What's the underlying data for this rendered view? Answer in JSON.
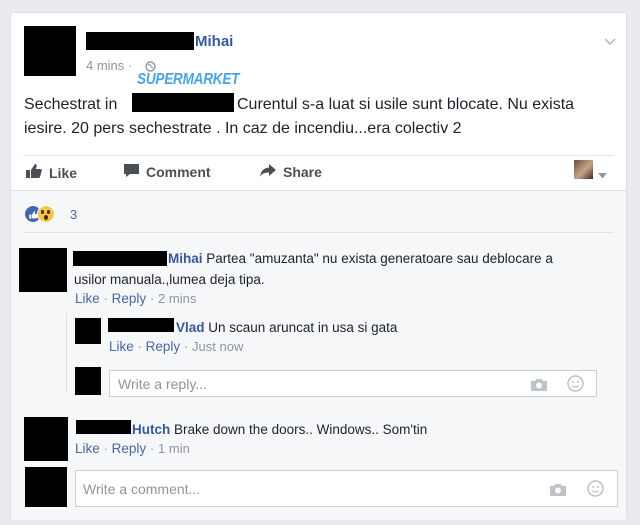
{
  "post": {
    "author_visible": "Mihai",
    "time": "4 mins",
    "time_separator": "·",
    "overlay_label": "SUPERMARKET",
    "text_start": "Sechestrat in",
    "text_end": "Curentul s-a luat si usile sunt blocate. Nu exista",
    "text_line2": "iesire. 20 pers sechestrate . In caz de incendiu...era colectiv 2"
  },
  "actions": {
    "like": "Like",
    "comment": "Comment",
    "share": "Share"
  },
  "reactions": {
    "count": "3",
    "types": [
      "like-icon",
      "wow-icon"
    ]
  },
  "comments": [
    {
      "author": "Mihai",
      "text_line1": "Partea \"amuzanta\" nu exista generatoare sau deblocare a",
      "text_line2": "usilor manuala.,lumea deja tipa.",
      "like": "Like",
      "reply": "Reply",
      "time": "2 mins",
      "sep": "·"
    },
    {
      "author": "Vlad",
      "text": "Un scaun aruncat in usa si gata",
      "like": "Like",
      "reply": "Reply",
      "time": "Just now",
      "sep": "·"
    },
    {
      "author": "Hutch",
      "text": "Brake down the doors.. Windows.. Som'tin",
      "like": "Like",
      "reply": "Reply",
      "time": "1 min",
      "sep": "·"
    }
  ],
  "inputs": {
    "reply_placeholder": "Write a reply...",
    "comment_placeholder": "Write a comment..."
  },
  "colors": {
    "name_blue": "#365899",
    "link_blue": "#4b67a1",
    "meta_gray": "#90949c",
    "overlay_blue": "#4aa3df"
  }
}
